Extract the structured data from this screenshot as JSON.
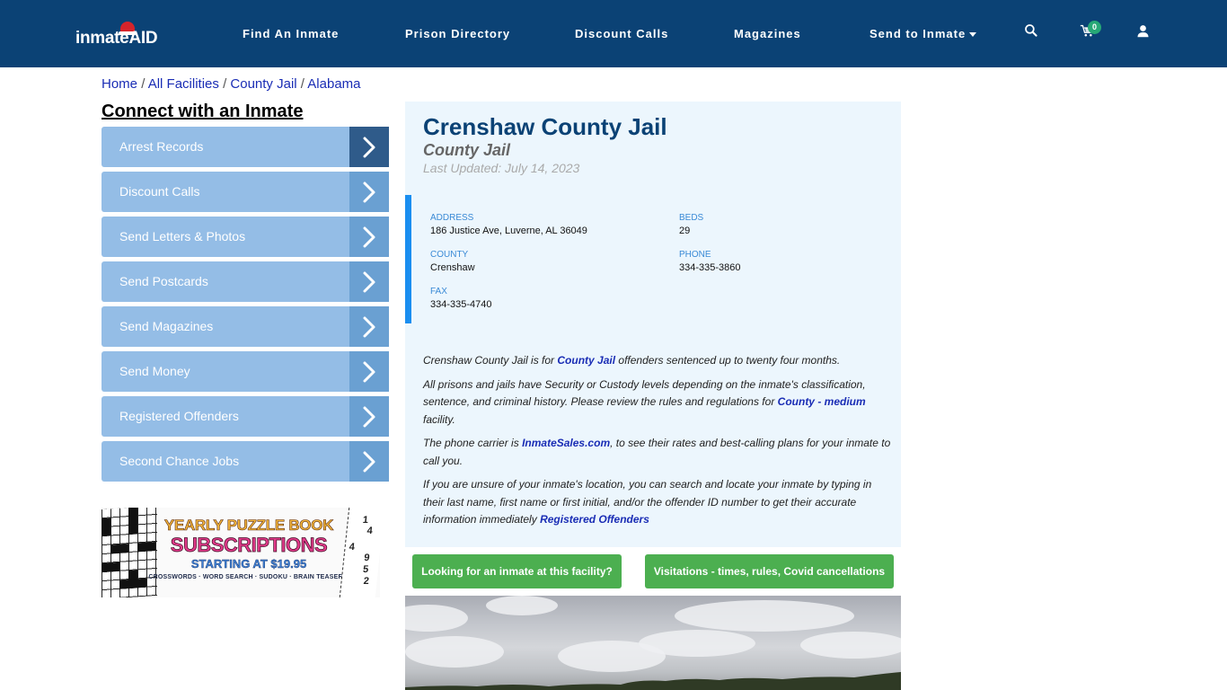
{
  "header": {
    "logo_text": "inmateAID",
    "nav": [
      {
        "label": "Find An Inmate"
      },
      {
        "label": "Prison Directory"
      },
      {
        "label": "Discount Calls"
      },
      {
        "label": "Magazines"
      },
      {
        "label": "Send to Inmate",
        "has_dropdown": true
      }
    ],
    "icons": {
      "search": "search-icon",
      "cart": "cart-icon",
      "user": "user-icon"
    },
    "cart_count": "0"
  },
  "breadcrumb": [
    {
      "label": "Home"
    },
    {
      "label": "All Facilities"
    },
    {
      "label": "County Jail"
    },
    {
      "label": "Alabama"
    }
  ],
  "breadcrumb_separator": "/",
  "sidebar": {
    "title": "Connect with an Inmate",
    "items": [
      {
        "label": "Arrest Records"
      },
      {
        "label": "Discount Calls"
      },
      {
        "label": "Send Letters & Photos"
      },
      {
        "label": "Send Postcards"
      },
      {
        "label": "Send Magazines"
      },
      {
        "label": "Send Money"
      },
      {
        "label": "Registered Offenders"
      },
      {
        "label": "Second Chance Jobs"
      }
    ],
    "ad": {
      "line1": "YEARLY PUZZLE BOOK",
      "line2": "SUBSCRIPTIONS",
      "line3": "STARTING AT $19.95",
      "line4": "CROSSWORDS · WORD SEARCH · SUDOKU · BRAIN TEASERS",
      "numbers": [
        "1",
        "4",
        "4",
        "9",
        "5",
        "2"
      ]
    }
  },
  "facility": {
    "name": "Crenshaw County Jail",
    "type": "County Jail",
    "last_updated": "Last Updated: July 14, 2023",
    "fields": {
      "address": {
        "label": "ADDRESS",
        "value": "186 Justice Ave, Luverne, AL 36049"
      },
      "beds": {
        "label": "BEDS",
        "value": "29"
      },
      "county": {
        "label": "COUNTY",
        "value": "Crenshaw"
      },
      "phone": {
        "label": "PHONE",
        "value": "334-335-3860"
      },
      "fax": {
        "label": "FAX",
        "value": "334-335-4740"
      }
    },
    "paragraphs": {
      "p1_a": "Crenshaw County Jail is for ",
      "p1_link": "County Jail",
      "p1_b": " offenders sentenced up to twenty four months.",
      "p2_a": "All prisons and jails have Security or Custody levels depending on the inmate's classification, sentence, and criminal history. Please review the rules and regulations for ",
      "p2_link": "County - medium",
      "p2_b": " facility.",
      "p3_a": "The phone carrier is ",
      "p3_link": "InmateSales.com",
      "p3_b": ", to see their rates and best-calling plans for your inmate to call you.",
      "p4_a": "If you are unsure of your inmate's location, you can search and locate your inmate by typing in their last name, first name or first initial, and/or the offender ID number to get their accurate information immediately ",
      "p4_link": "Registered Offenders"
    }
  },
  "buttons": {
    "find_inmate": "Looking for an inmate at this facility?",
    "visitations": "Visitations - times, rules, Covid cancellations"
  },
  "colors": {
    "header_bg": "#0b4275",
    "sidebar_item": "#94bde6",
    "sidebar_arrow": "#6aa0d2",
    "sidebar_arrow_active": "#2f5b8a",
    "card_bg": "#ecf6fd",
    "accent_bar": "#1a8ef0",
    "button_green": "#4caf50",
    "link": "#1a2db5"
  }
}
